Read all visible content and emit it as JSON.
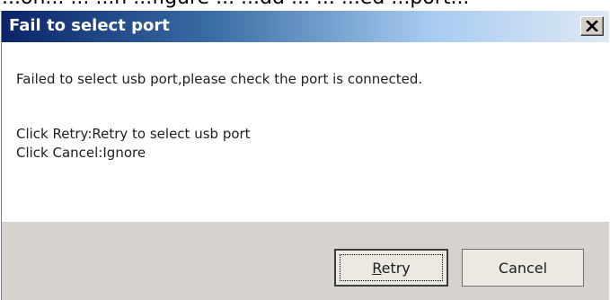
{
  "background": {
    "partial_text": "...on... ... ...n ...figure ... ...dd ... ... ...ed ...port..."
  },
  "dialog": {
    "title": "Fail to select port",
    "close_label": "×",
    "message": "Failed to select usb port,please check the port is connected.",
    "instruction_retry": "Click Retry:Retry to select usb port",
    "instruction_cancel": "Click Cancel:Ignore",
    "buttons": {
      "retry_label": "Retry",
      "cancel_label": "Cancel"
    }
  },
  "colors": {
    "titlebar_start": "#0a246a",
    "titlebar_end": "#dfe9f5",
    "button_area": "#d6d3ce"
  }
}
